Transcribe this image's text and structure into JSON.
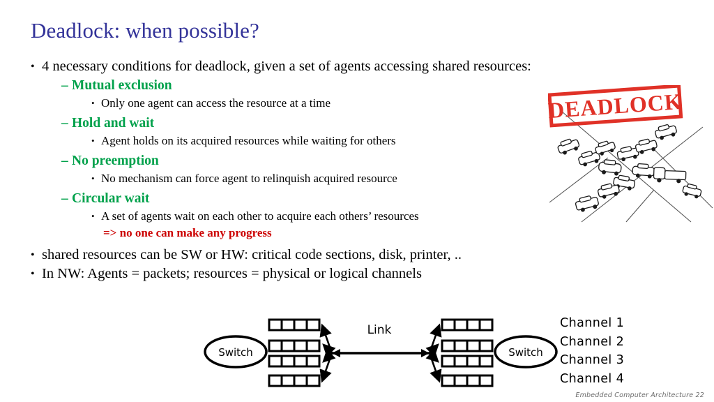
{
  "slide": {
    "title": "Deadlock: when possible?",
    "footer": "Embedded Computer Architecture  22"
  },
  "body": {
    "intro": {
      "bullet": "•",
      "text": "4 necessary conditions for deadlock, given a set of agents accessing shared resources:"
    },
    "conditions": [
      {
        "dash": "–",
        "name": "Mutual exclusion",
        "bullet": "•",
        "detail": "Only one agent can access the resource at a time",
        "note": ""
      },
      {
        "dash": "–",
        "name": "Hold and wait",
        "bullet": "•",
        "detail": "Agent holds on its acquired resources while waiting for others",
        "note": ""
      },
      {
        "dash": "–",
        "name": "No preemption",
        "bullet": "•",
        "detail": "No mechanism can force agent to relinquish acquired resource",
        "note": ""
      },
      {
        "dash": "–",
        "name": "Circular wait",
        "bullet": "•",
        "detail": "A set of agents wait on each other to acquire each others’ resources",
        "note": "=> no one can make any progress"
      }
    ],
    "closing": [
      {
        "bullet": "•",
        "text": "shared resources can be SW or HW: critical code sections, disk, printer, .."
      },
      {
        "bullet": "•",
        "text": "In NW: Agents = packets; resources = physical or logical channels"
      }
    ]
  },
  "deadlock_figure": {
    "stamp_label": "DEADLOCK",
    "stamp_color": "#E03127",
    "description": "traffic gridlock cartoon at a crossroads"
  },
  "network_diagram": {
    "left_switch_label": "Switch",
    "right_switch_label": "Switch",
    "link_label": "Link",
    "buffer_rows": 4,
    "buffer_cells_per_row": 4
  },
  "channels": {
    "items": [
      "Channel 1",
      "Channel 2",
      "Channel 3",
      "Channel 4"
    ]
  },
  "colors": {
    "title": "#333399",
    "heading_green": "#00A14B",
    "note_red": "#CC0000",
    "footer_gray": "#6b6b6b"
  }
}
